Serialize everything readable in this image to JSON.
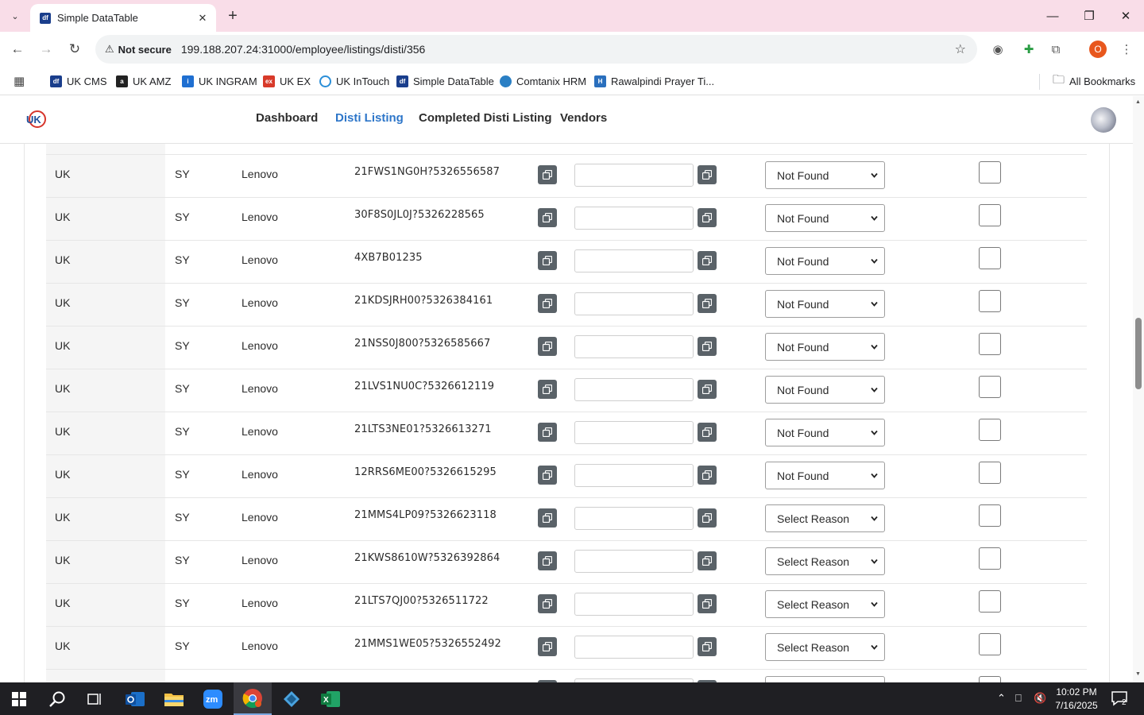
{
  "browser": {
    "tab_title": "Simple DataTable",
    "tab_favicon": "df",
    "security_label": "Not secure",
    "url": "199.188.207.24:31000/employee/listings/disti/356",
    "profile_initial": "O"
  },
  "bookmarks": [
    {
      "label": "UK CMS",
      "icon": "df-icon",
      "color": "#1a3e8c"
    },
    {
      "label": "UK AMZ",
      "icon": "amazon-icon",
      "color": "#222222"
    },
    {
      "label": "UK INGRAM",
      "icon": "ingram-icon",
      "color": "#1f6fd1"
    },
    {
      "label": "UK EX",
      "icon": "ex-icon",
      "color": "#d83a2a"
    },
    {
      "label": "UK InTouch",
      "icon": "intouch-icon",
      "color": "#2b8fd8"
    },
    {
      "label": "Simple DataTable",
      "icon": "df-icon",
      "color": "#1a3e8c"
    },
    {
      "label": "Comtanix HRM",
      "icon": "hrm-icon",
      "color": "#2a7fc4"
    },
    {
      "label": "Rawalpindi Prayer Ti...",
      "icon": "prayer-icon",
      "color": "#2a6fbd"
    }
  ],
  "all_bookmarks_label": "All Bookmarks",
  "nav": {
    "items": [
      {
        "label": "Dashboard",
        "active": false
      },
      {
        "label": "Disti Listing",
        "active": true
      },
      {
        "label": "Completed Disti Listing",
        "active": false
      },
      {
        "label": "Vendors",
        "active": false
      }
    ]
  },
  "rows": [
    {
      "country": "UK",
      "code": "SY",
      "brand": "Lenovo",
      "part": "21FWS1NG0H?5326556587",
      "reason": "Not Found"
    },
    {
      "country": "UK",
      "code": "SY",
      "brand": "Lenovo",
      "part": "30F8S0JL0J?5326228565",
      "reason": "Not Found"
    },
    {
      "country": "UK",
      "code": "SY",
      "brand": "Lenovo",
      "part": "4XB7B01235",
      "reason": "Not Found"
    },
    {
      "country": "UK",
      "code": "SY",
      "brand": "Lenovo",
      "part": "21KDSJRH00?5326384161",
      "reason": "Not Found"
    },
    {
      "country": "UK",
      "code": "SY",
      "brand": "Lenovo",
      "part": "21NSS0J800?5326585667",
      "reason": "Not Found"
    },
    {
      "country": "UK",
      "code": "SY",
      "brand": "Lenovo",
      "part": "21LVS1NU0C?5326612119",
      "reason": "Not Found"
    },
    {
      "country": "UK",
      "code": "SY",
      "brand": "Lenovo",
      "part": "21LTS3NE01?5326613271",
      "reason": "Not Found"
    },
    {
      "country": "UK",
      "code": "SY",
      "brand": "Lenovo",
      "part": "12RRS6ME00?5326615295",
      "reason": "Not Found"
    },
    {
      "country": "UK",
      "code": "SY",
      "brand": "Lenovo",
      "part": "21MMS4LP09?5326623118",
      "reason": "Select Reason"
    },
    {
      "country": "UK",
      "code": "SY",
      "brand": "Lenovo",
      "part": "21KWS8610W?5326392864",
      "reason": "Select Reason"
    },
    {
      "country": "UK",
      "code": "SY",
      "brand": "Lenovo",
      "part": "21LTS7QJ00?5326511722",
      "reason": "Select Reason"
    },
    {
      "country": "UK",
      "code": "SY",
      "brand": "Lenovo",
      "part": "21MMS1WE05?5326552492",
      "reason": "Select Reason"
    }
  ],
  "taskbar": {
    "time": "10:02 PM",
    "date": "7/16/2025",
    "notification_count": "2"
  },
  "colors": {
    "accent": "#2e76c9",
    "titlebar": "#f9dde8",
    "copy_button": "#5a6268"
  }
}
